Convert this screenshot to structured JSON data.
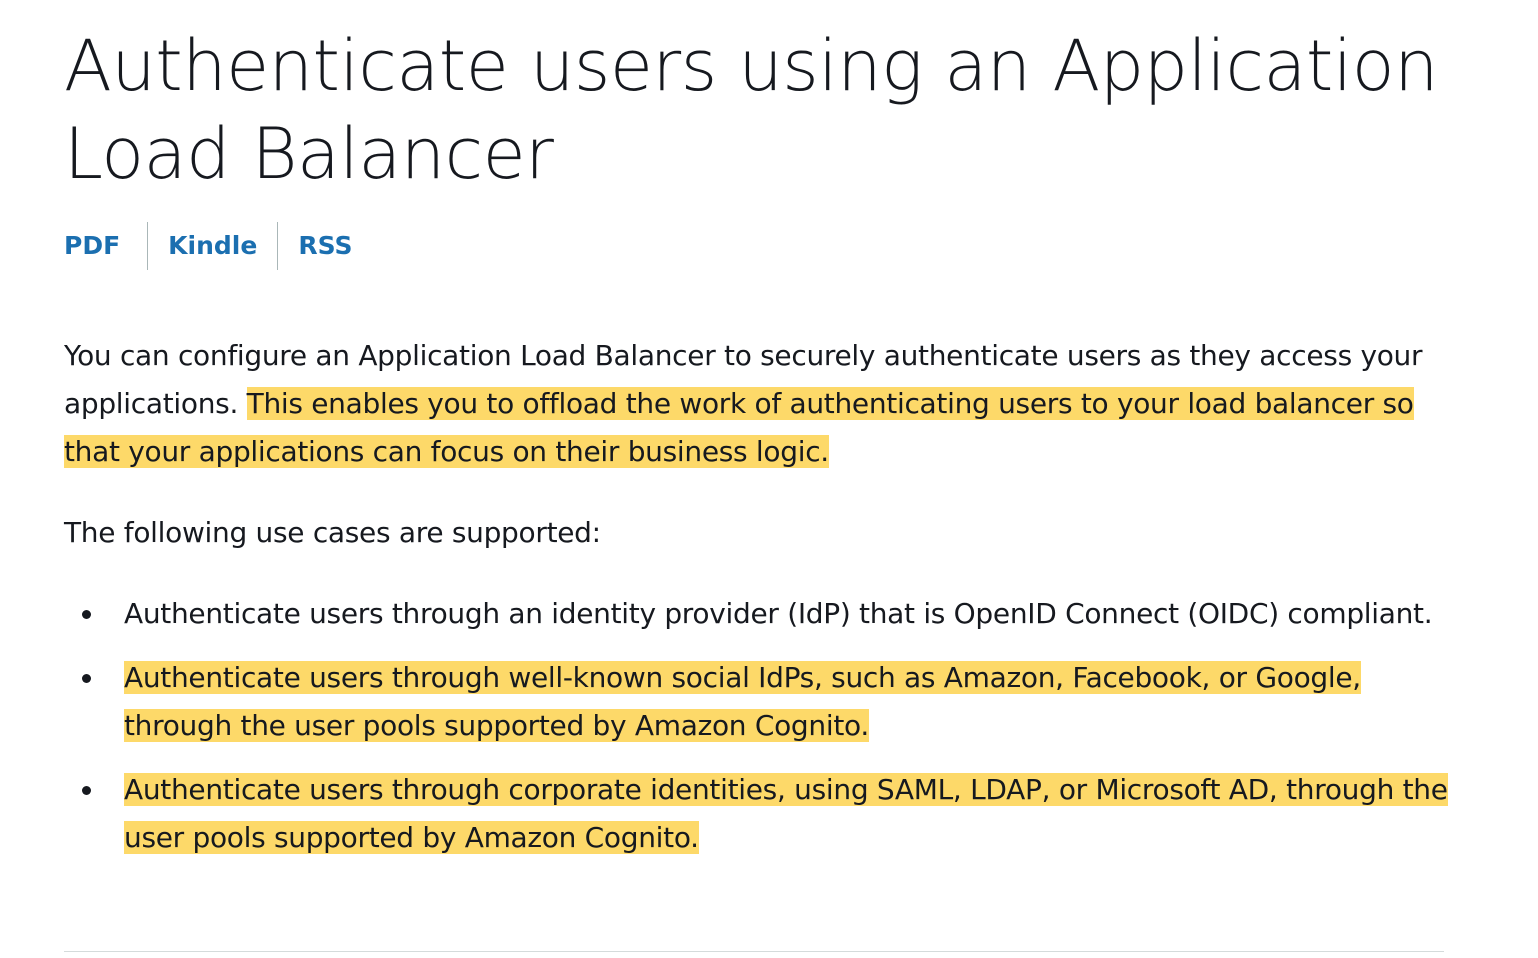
{
  "page": {
    "title": "Authenticate users using an Application Load Balancer",
    "formats": {
      "pdf": "PDF",
      "kindle": "Kindle",
      "rss": "RSS"
    },
    "intro": {
      "plain": "You can configure an Application Load Balancer to securely authenticate users as they access your applications. ",
      "highlighted": "This enables you to offload the work of authenticating users to your load balancer so that your applications can focus on their business logic."
    },
    "lead": "The following use cases are supported:",
    "use_cases": [
      {
        "text": "Authenticate users through an identity provider (IdP) that is OpenID Connect (OIDC) compliant.",
        "highlighted": false
      },
      {
        "text": "Authenticate users through well-known social IdPs, such as Amazon, Facebook, or Google, through the user pools supported by Amazon Cognito.",
        "highlighted": true
      },
      {
        "text": "Authenticate users through corporate identities, using SAML, LDAP, or Microsoft AD, through the user pools supported by Amazon Cognito.",
        "highlighted": true
      }
    ]
  },
  "colors": {
    "link": "#1b6fb0",
    "highlight": "#fdd969",
    "text": "#16191f"
  }
}
